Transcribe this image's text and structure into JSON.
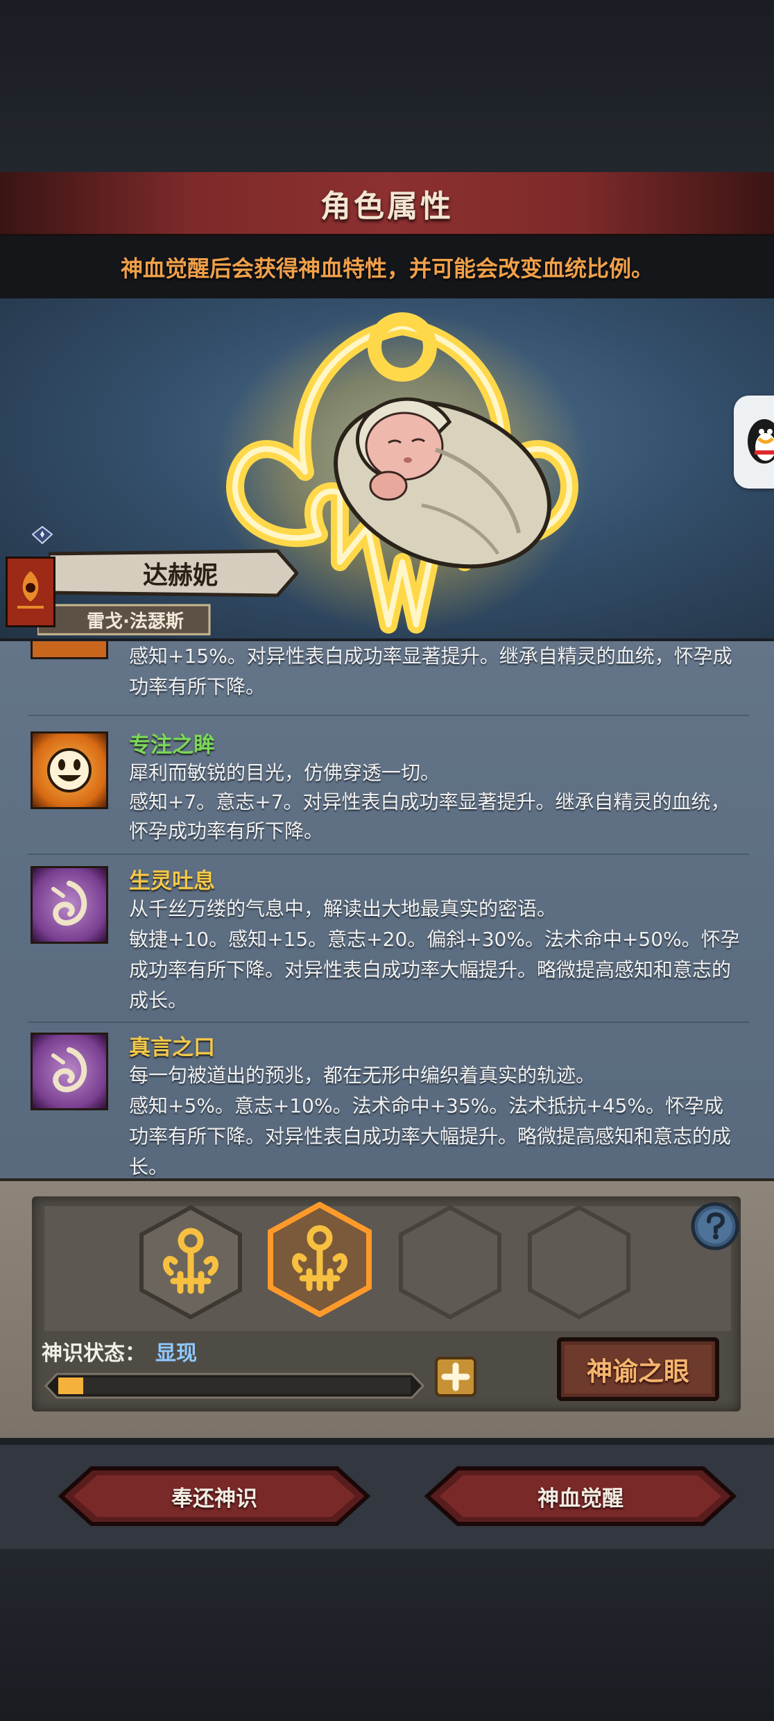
{
  "header": {
    "title": "角色属性"
  },
  "notice": {
    "text": "神血觉醒后会获得神血特性，并可能会改变血统比例。"
  },
  "character": {
    "name": "达赫妮",
    "title": "雷戈·法瑟斯"
  },
  "traits": [
    {
      "name": "",
      "name_color": "#ffffff",
      "lines": [
        "感知+15%。对异性表白成功率显著提升。继承自精灵的血统，怀孕成",
        "功率有所下降。"
      ],
      "icon": "partial-trait-icon"
    },
    {
      "name": "专注之眸",
      "name_color": "#7bd85a",
      "lines": [
        "犀利而敏锐的目光，仿佛穿透一切。",
        "感知+7。意志+7。对异性表白成功率显著提升。继承自精灵的血统，",
        "怀孕成功率有所下降。"
      ],
      "icon": "sun-face-icon"
    },
    {
      "name": "生灵吐息",
      "name_color": "#f3c84a",
      "lines": [
        "从千丝万缕的气息中，解读出大地最真实的密语。",
        "敏捷+10。感知+15。意志+20。偏斜+30%。法术命中+50%。怀孕",
        "成功率有所下降。对异性表白成功率大幅提升。略微提高感知和意志的",
        "成长。"
      ],
      "icon": "spiral-swirl-icon"
    },
    {
      "name": "真言之口",
      "name_color": "#f3c84a",
      "lines": [
        "每一句被道出的预兆，都在无形中编织着真实的轨迹。",
        "感知+5%。意志+10%。法术命中+35%。法术抵抗+45%。怀孕成",
        "功率有所下降。对异性表白成功率大幅提升。略微提高感知和意志的成",
        "长。"
      ],
      "icon": "spiral-swirl-icon"
    }
  ],
  "awakening": {
    "slots": [
      {
        "state": "filled",
        "icon": "divine-crest-icon"
      },
      {
        "state": "selected",
        "icon": "divine-crest-icon"
      },
      {
        "state": "empty",
        "icon": ""
      },
      {
        "state": "empty",
        "icon": ""
      }
    ],
    "status_label": "神识状态：",
    "status_value": "显现",
    "progress": 0.07,
    "oracle_button": "神谕之眼"
  },
  "buttons": {
    "return": "奉还神识",
    "awaken": "神血觉醒"
  },
  "colors": {
    "accent_orange": "#f0a04a",
    "title_red": "#8c3030",
    "status_blue": "#8ec9ff"
  }
}
